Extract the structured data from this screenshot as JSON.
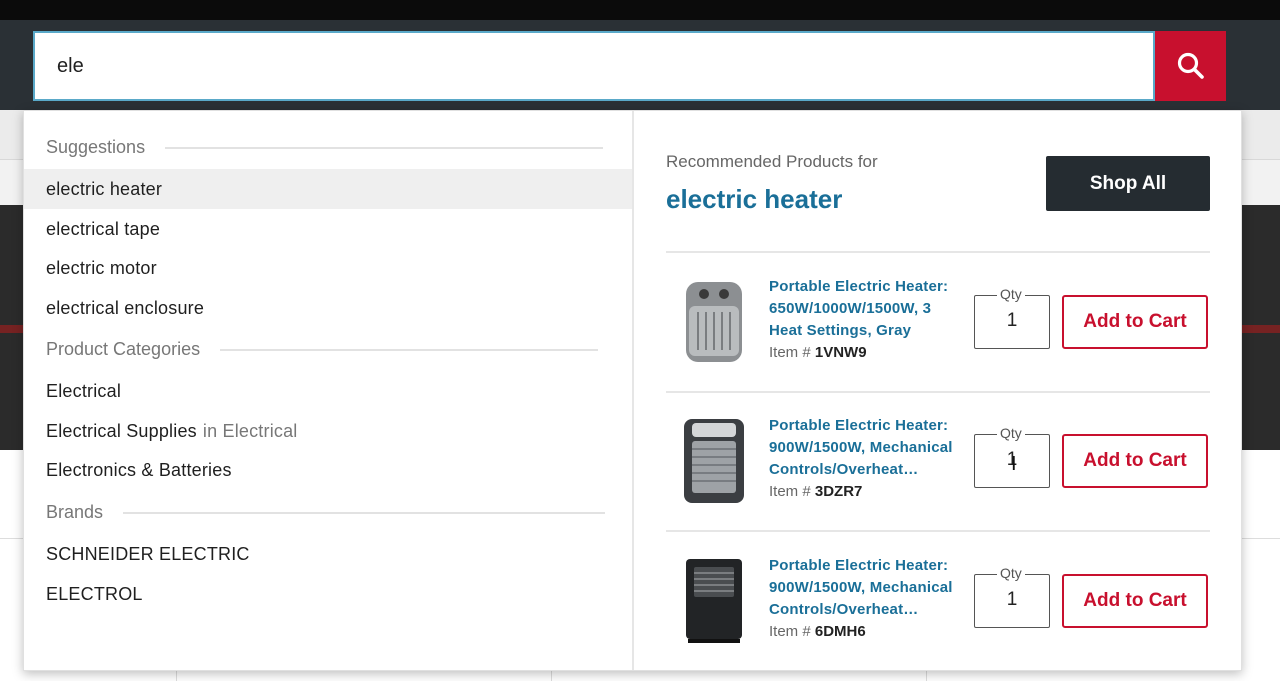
{
  "search": {
    "value": "ele",
    "button_icon": "search-icon"
  },
  "suggestions": {
    "heading": "Suggestions",
    "items": [
      {
        "label": "electric heater",
        "active": true
      },
      {
        "label": "electrical tape"
      },
      {
        "label": "electric motor"
      },
      {
        "label": "electrical enclosure"
      }
    ]
  },
  "categories": {
    "heading": "Product Categories",
    "items": [
      {
        "label": "Electrical"
      },
      {
        "label": "Electrical Supplies",
        "suffix": "in Electrical"
      },
      {
        "label": "Electronics & Batteries"
      }
    ]
  },
  "brands": {
    "heading": "Brands",
    "items": [
      {
        "label": "SCHNEIDER ELECTRIC"
      },
      {
        "label": "ELECTROL"
      }
    ]
  },
  "recommended": {
    "label": "Recommended Products for",
    "term": "electric heater",
    "shop_all": "Shop All",
    "products": [
      {
        "title": "Portable Electric Heater: 650W/1000W/1500W, 3 Heat Settings, Gray",
        "item_prefix": "Item #",
        "item_no": "1VNW9",
        "qty_label": "Qty",
        "qty": "1",
        "add_label": "Add to Cart"
      },
      {
        "title": "Portable Electric Heater: 900W/1500W, Mechanical Controls/Overheat…",
        "item_prefix": "Item #",
        "item_no": "3DZR7",
        "qty_label": "Qty",
        "qty": "1",
        "add_label": "Add to Cart"
      },
      {
        "title": "Portable Electric Heater: 900W/1500W, Mechanical Controls/Overheat…",
        "item_prefix": "Item #",
        "item_no": "6DMH6",
        "qty_label": "Qty",
        "qty": "1",
        "add_label": "Add to Cart"
      }
    ]
  },
  "colors": {
    "accent_red": "#c8102e",
    "link_blue": "#1a6f98",
    "header_dark": "#2a3035"
  }
}
